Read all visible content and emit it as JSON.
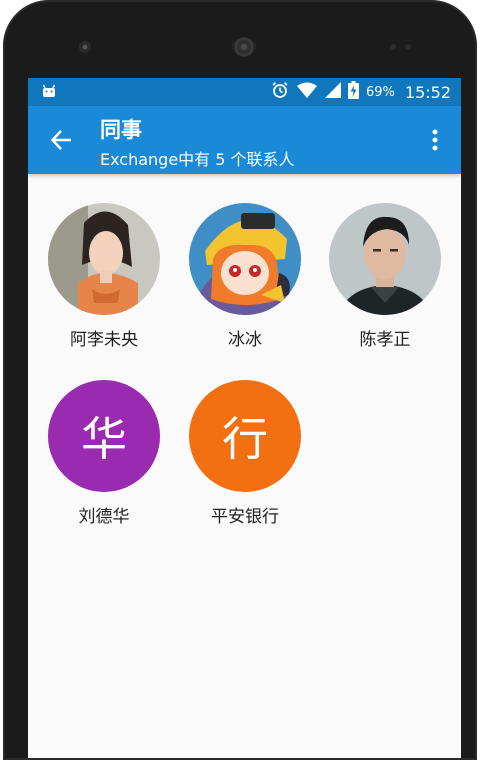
{
  "status_bar": {
    "battery": "69%",
    "time": "15:52",
    "icons": [
      "android-icon",
      "alarm-icon",
      "wifi-icon",
      "cell-signal-icon",
      "battery-charging-icon"
    ]
  },
  "app_bar": {
    "title": "同事",
    "subtitle": "Exchange中有 5 个联系人",
    "back_icon": "back-arrow-icon",
    "menu_icon": "overflow-menu-icon"
  },
  "contacts": [
    {
      "name": "阿李未央",
      "avatar": "photo"
    },
    {
      "name": "冰冰",
      "avatar": "photo"
    },
    {
      "name": "陈孝正",
      "avatar": "photo"
    },
    {
      "name": "刘德华",
      "avatar": "letter",
      "letter": "华",
      "color": "#9a2bb0"
    },
    {
      "name": "平安银行",
      "avatar": "letter",
      "letter": "行",
      "color": "#f27012"
    }
  ],
  "colors": {
    "status_bar": "#1077bd",
    "app_bar": "#1a8ad8"
  }
}
